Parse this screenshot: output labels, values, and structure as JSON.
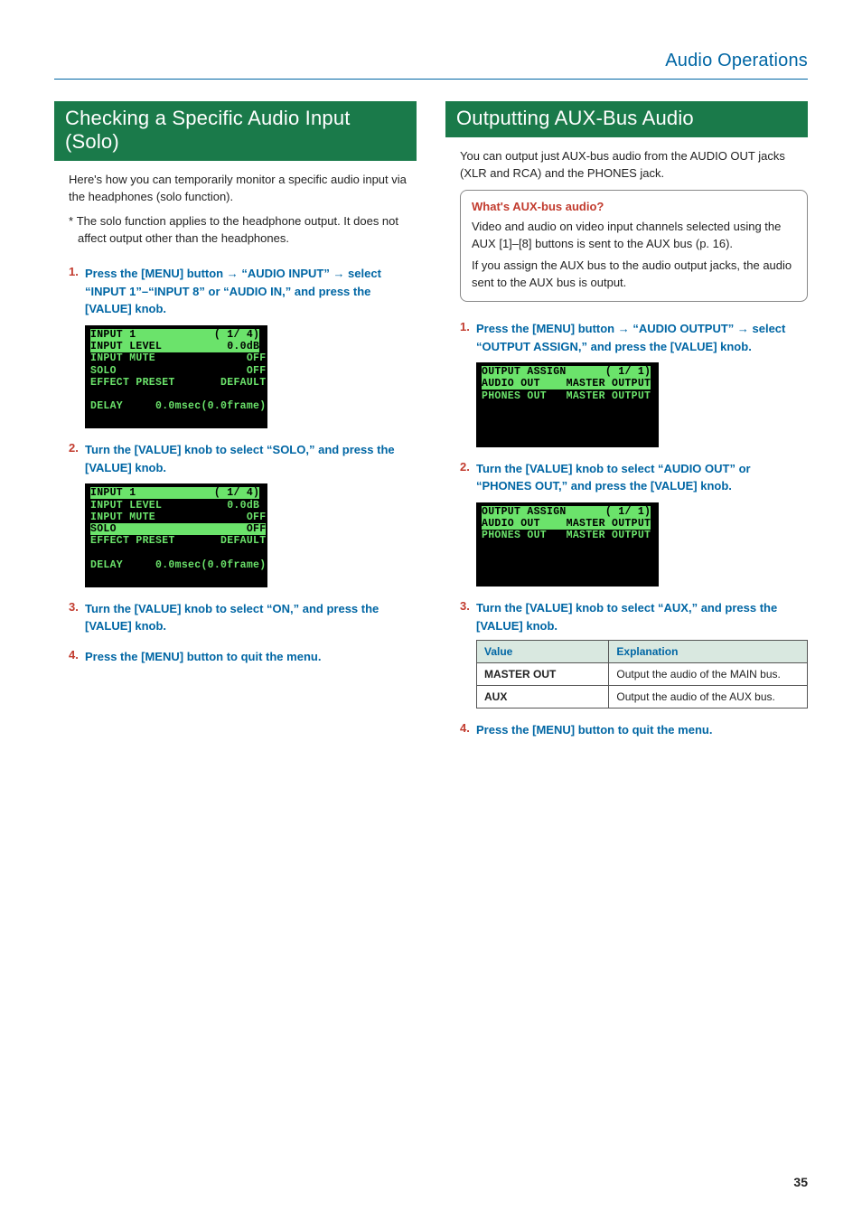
{
  "header": {
    "section": "Audio Operations"
  },
  "page_number": "35",
  "left": {
    "title": "Checking a Specific Audio Input (Solo)",
    "intro": "Here's how you can temporarily monitor a specific audio input via the headphones (solo function).",
    "note_ast": "*",
    "note": "The solo function applies to the headphone output. It does not affect output other than the headphones.",
    "step1": "Press the [MENU] button → “AUDIO INPUT” → select “INPUT 1”–“INPUT 8” or “AUDIO IN,” and press the [VALUE] knob.",
    "step2": "Turn the [VALUE] knob to select “SOLO,” and press the [VALUE] knob.",
    "step3": "Turn the [VALUE] knob to select “ON,” and press the [VALUE] knob.",
    "step4": "Press the [MENU] button to quit the menu.",
    "lcd1": {
      "l1a": "INPUT 1",
      "l1b": "( 1/ 4)",
      "l2a": "INPUT LEVEL",
      "l2b": "0.0dB",
      "l3a": "INPUT MUTE",
      "l3b": "OFF",
      "l4a": "SOLO",
      "l4b": "OFF",
      "l5a": "EFFECT PRESET",
      "l5b": "DEFAULT",
      "l6a": "DELAY",
      "l6b": "0.0msec(0.0frame)"
    },
    "lcd2": {
      "l1a": "INPUT 1",
      "l1b": "( 1/ 4)",
      "l2a": "INPUT LEVEL",
      "l2b": "0.0dB",
      "l3a": "INPUT MUTE",
      "l3b": "OFF",
      "l4a": "SOLO",
      "l4b": "OFF",
      "l5a": "EFFECT PRESET",
      "l5b": "DEFAULT",
      "l6a": "DELAY",
      "l6b": "0.0msec(0.0frame)"
    }
  },
  "right": {
    "title": "Outputting AUX-Bus Audio",
    "intro": "You can output just AUX-bus audio from the AUDIO OUT jacks (XLR and RCA) and the PHONES jack.",
    "callout_title": "What's AUX-bus audio?",
    "callout_p1": "Video and audio on video input channels selected using the AUX [1]–[8] buttons is sent to the AUX bus (p. 16).",
    "callout_p2": "If you assign the AUX bus to the audio output jacks, the audio sent to the AUX bus is output.",
    "step1": "Press the [MENU] button → “AUDIO OUTPUT” → select “OUTPUT ASSIGN,” and press the [VALUE] knob.",
    "step2": "Turn the [VALUE] knob to select “AUDIO OUT” or “PHONES OUT,” and press the [VALUE] knob.",
    "step3": "Turn the [VALUE] knob to select “AUX,” and press the [VALUE] knob.",
    "step4": "Press the [MENU] button to quit the menu.",
    "lcd1": {
      "l1a": "OUTPUT ASSIGN",
      "l1b": "( 1/ 1)",
      "l2a": "AUDIO OUT",
      "l2b": "MASTER OUTPUT",
      "l3a": "PHONES OUT",
      "l3b": "MASTER OUTPUT"
    },
    "lcd2": {
      "l1a": "OUTPUT ASSIGN",
      "l1b": "( 1/ 1)",
      "l2a": "AUDIO OUT",
      "l2b": "MASTER OUTPUT",
      "l3a": "PHONES OUT",
      "l3b": "MASTER OUTPUT"
    },
    "table": {
      "h1": "Value",
      "h2": "Explanation",
      "r1k": "MASTER OUT",
      "r1v": "Output the audio of the MAIN bus.",
      "r2k": "AUX",
      "r2v": "Output the audio of the AUX bus."
    }
  }
}
